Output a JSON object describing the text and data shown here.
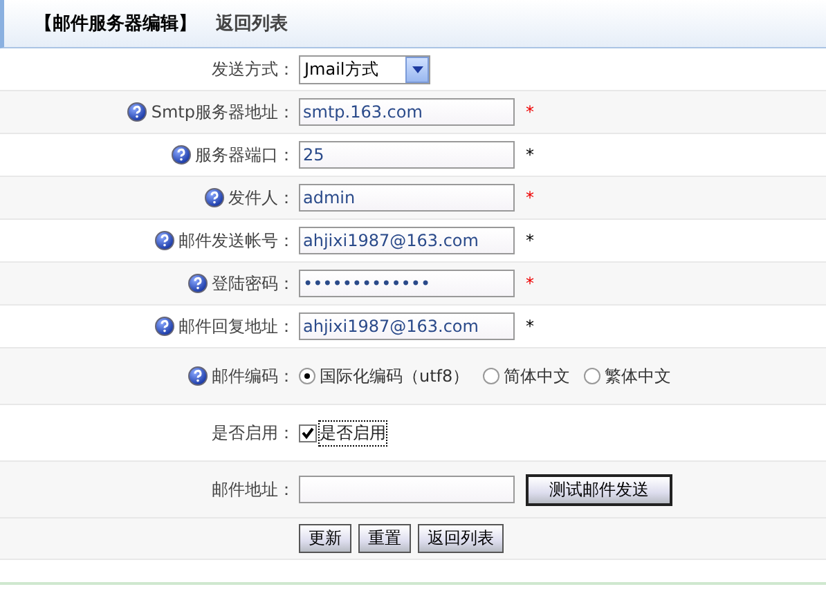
{
  "header": {
    "title": "【邮件服务器编辑】",
    "back_link": "返回列表"
  },
  "rows": [
    {
      "kind": "select",
      "label": "发送方式：",
      "help": false,
      "value": "Jmail方式"
    },
    {
      "kind": "text",
      "label": "Smtp服务器地址：",
      "help": true,
      "value": "smtp.163.com",
      "mark": "*",
      "required": true
    },
    {
      "kind": "text",
      "label": "服务器端口：",
      "help": true,
      "value": "25",
      "mark": "*",
      "required": false
    },
    {
      "kind": "text",
      "label": "发件人：",
      "help": true,
      "value": "admin",
      "mark": "*",
      "required": true
    },
    {
      "kind": "text",
      "label": "邮件发送帐号：",
      "help": true,
      "value": "ahjixi1987@163.com",
      "mark": "*",
      "required": false
    },
    {
      "kind": "text",
      "label": "登陆密码：",
      "help": true,
      "value": "•••••••••••••",
      "mark": "*",
      "required": true
    },
    {
      "kind": "text",
      "label": "邮件回复地址：",
      "help": true,
      "value": "ahjixi1987@163.com",
      "mark": "*",
      "required": false
    },
    {
      "kind": "radio",
      "label": "邮件编码：",
      "help": true,
      "options": [
        {
          "label": "国际化编码（utf8）",
          "selected": true
        },
        {
          "label": "简体中文",
          "selected": false
        },
        {
          "label": "繁体中文",
          "selected": false
        }
      ]
    },
    {
      "kind": "checkbox",
      "label": "是否启用：",
      "help": false,
      "option": "是否启用",
      "checked": true
    },
    {
      "kind": "test",
      "label": "邮件地址：",
      "help": false,
      "button": "测试邮件发送"
    }
  ],
  "buttons": [
    "更新",
    "重置",
    "返回列表"
  ]
}
